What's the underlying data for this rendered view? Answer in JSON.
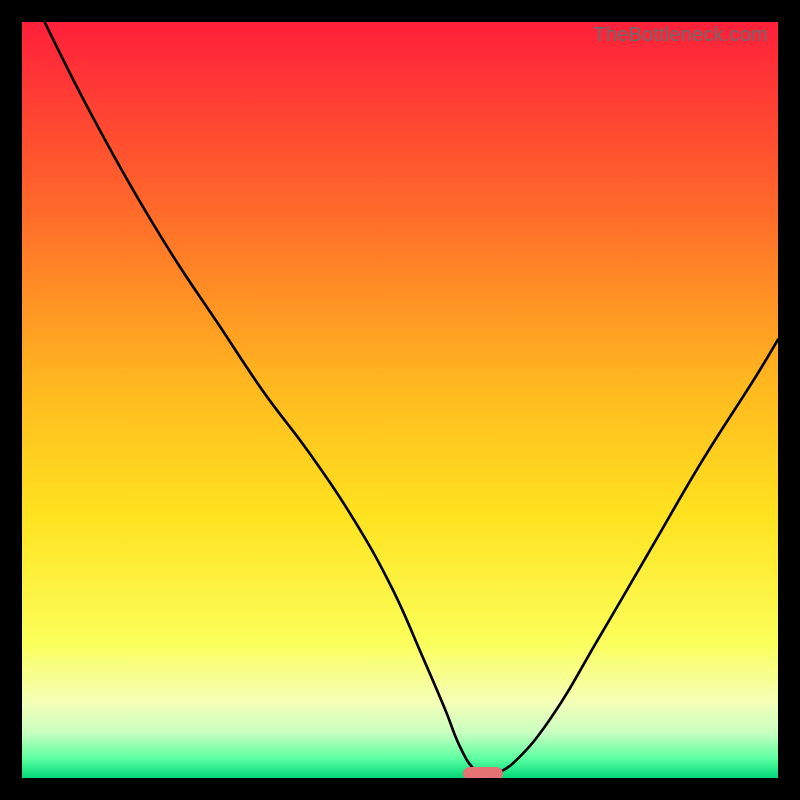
{
  "watermark": "TheBottleneck.com",
  "colors": {
    "frame": "#000000",
    "top": "#ff1f3a",
    "mid1": "#ff8a2a",
    "mid2": "#ffd21f",
    "mid3": "#fff06a",
    "mid4": "#f8ffa8",
    "green1": "#a8ffb0",
    "green2": "#00e07a",
    "curve": "#000000",
    "marker": "#e57373"
  },
  "chart_data": {
    "type": "line",
    "title": "",
    "xlabel": "",
    "ylabel": "",
    "xlim": [
      0,
      100
    ],
    "ylim": [
      0,
      100
    ],
    "series": [
      {
        "name": "curve",
        "x": [
          3,
          8,
          14,
          20,
          26,
          32,
          38,
          44,
          49,
          53,
          56,
          58,
          60,
          62,
          65,
          70,
          76,
          83,
          90,
          97,
          100
        ],
        "y": [
          100,
          90,
          79,
          69,
          60,
          51,
          43,
          34,
          25,
          16,
          9,
          4,
          1,
          0.5,
          2,
          8,
          18,
          30,
          42,
          53,
          58
        ]
      }
    ],
    "marker": {
      "x": 61,
      "y": 0.5
    },
    "gradient_stops": [
      {
        "pos": 0,
        "color": "#ff1f3a"
      },
      {
        "pos": 0.25,
        "color": "#ff6a2a"
      },
      {
        "pos": 0.48,
        "color": "#ffb81f"
      },
      {
        "pos": 0.65,
        "color": "#ffe21f"
      },
      {
        "pos": 0.82,
        "color": "#fbff5a"
      },
      {
        "pos": 0.9,
        "color": "#f4ffb8"
      },
      {
        "pos": 0.94,
        "color": "#c8ffc0"
      },
      {
        "pos": 0.975,
        "color": "#5affa0"
      },
      {
        "pos": 1.0,
        "color": "#00d878"
      }
    ]
  }
}
